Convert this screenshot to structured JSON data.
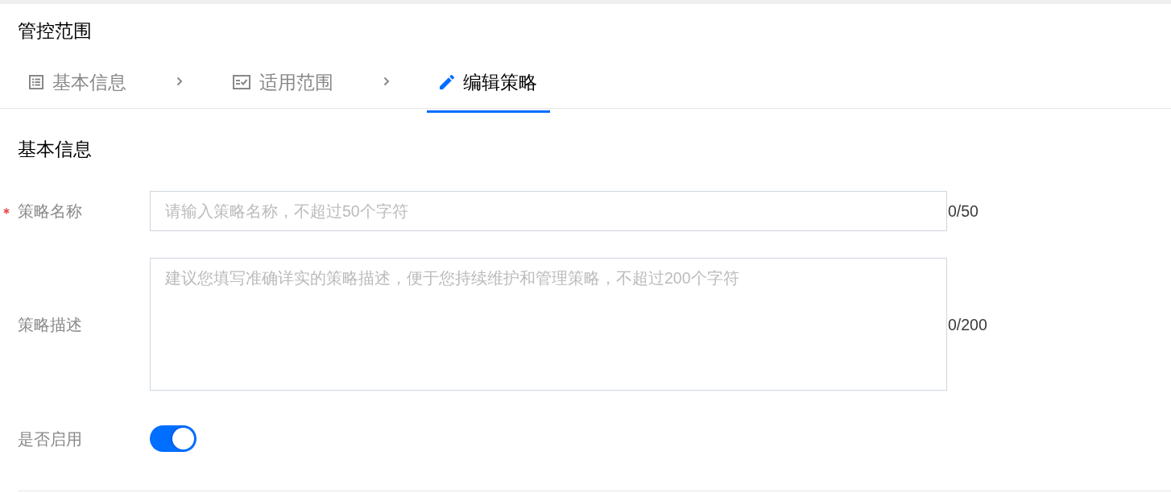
{
  "page": {
    "title": "管控范围"
  },
  "steps": [
    {
      "label": "基本信息",
      "selected": false
    },
    {
      "label": "适用范围",
      "selected": false
    },
    {
      "label": "编辑策略",
      "selected": true
    }
  ],
  "section": {
    "title": "基本信息"
  },
  "form": {
    "fields": [
      {
        "kind": "input",
        "label": "策略名称",
        "required": true,
        "placeholder": "请输入策略名称，不超过50个字符",
        "counter": "0/50"
      },
      {
        "kind": "textarea",
        "label": "策略描述",
        "required": false,
        "placeholder": "建议您填写准确详实的策略描述，便于您持续维护和管理策略，不超过200个字符",
        "counter": "0/200"
      },
      {
        "kind": "switch",
        "label": "是否启用",
        "required": false,
        "on": true
      }
    ]
  }
}
